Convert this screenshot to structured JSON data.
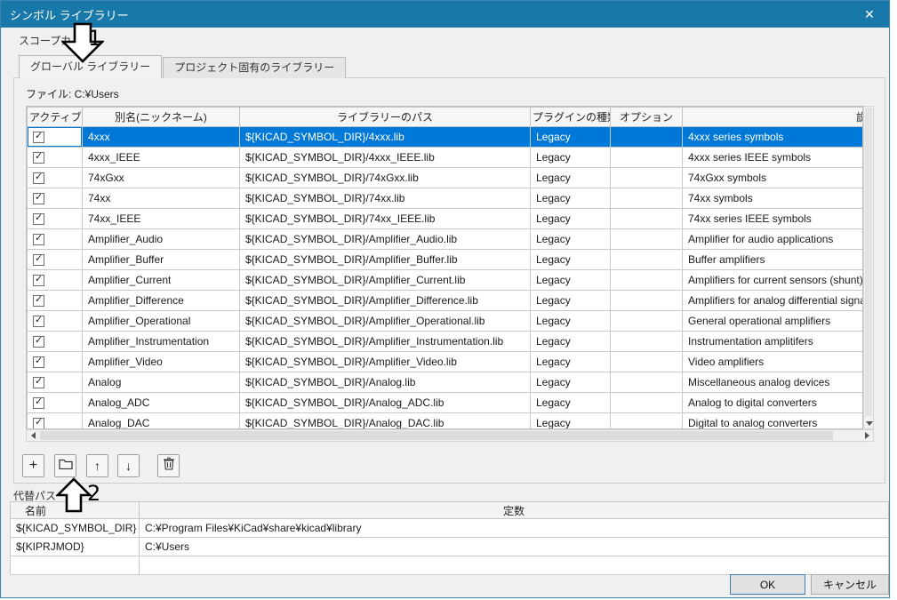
{
  "colors": {
    "titlebar": "#1878aa",
    "selection": "#0078d7",
    "dialog_bg": "#f0f0f0"
  },
  "dialog": {
    "title": "シンボル ライブラリー",
    "close_glyph": "✕"
  },
  "scope": {
    "label": "スコープカ",
    "tabs": [
      {
        "label": "グローバル ライブラリー",
        "active": true
      },
      {
        "label": "プロジェクト固有のライブラリー",
        "active": false
      }
    ],
    "file_label": "ファイル:  C:¥Users"
  },
  "grid": {
    "columns": [
      "アクティブ",
      "別名(ニックネーム)",
      "ライブラリーのパス",
      "プラグインの種類",
      "オプション",
      "説明"
    ],
    "rows": [
      {
        "active": true,
        "selected": true,
        "nickname": "4xxx",
        "path": "${KICAD_SYMBOL_DIR}/4xxx.lib",
        "plugin": "Legacy",
        "options": "",
        "description": "4xxx series symbols"
      },
      {
        "active": true,
        "selected": false,
        "nickname": "4xxx_IEEE",
        "path": "${KICAD_SYMBOL_DIR}/4xxx_IEEE.lib",
        "plugin": "Legacy",
        "options": "",
        "description": "4xxx series IEEE symbols"
      },
      {
        "active": true,
        "selected": false,
        "nickname": "74xGxx",
        "path": "${KICAD_SYMBOL_DIR}/74xGxx.lib",
        "plugin": "Legacy",
        "options": "",
        "description": "74xGxx symbols"
      },
      {
        "active": true,
        "selected": false,
        "nickname": "74xx",
        "path": "${KICAD_SYMBOL_DIR}/74xx.lib",
        "plugin": "Legacy",
        "options": "",
        "description": "74xx symbols"
      },
      {
        "active": true,
        "selected": false,
        "nickname": "74xx_IEEE",
        "path": "${KICAD_SYMBOL_DIR}/74xx_IEEE.lib",
        "plugin": "Legacy",
        "options": "",
        "description": "74xx series IEEE symbols"
      },
      {
        "active": true,
        "selected": false,
        "nickname": "Amplifier_Audio",
        "path": "${KICAD_SYMBOL_DIR}/Amplifier_Audio.lib",
        "plugin": "Legacy",
        "options": "",
        "description": "Amplifier for audio applications"
      },
      {
        "active": true,
        "selected": false,
        "nickname": "Amplifier_Buffer",
        "path": "${KICAD_SYMBOL_DIR}/Amplifier_Buffer.lib",
        "plugin": "Legacy",
        "options": "",
        "description": "Buffer amplifiers"
      },
      {
        "active": true,
        "selected": false,
        "nickname": "Amplifier_Current",
        "path": "${KICAD_SYMBOL_DIR}/Amplifier_Current.lib",
        "plugin": "Legacy",
        "options": "",
        "description": "Amplifiers for current sensors (shunt)"
      },
      {
        "active": true,
        "selected": false,
        "nickname": "Amplifier_Difference",
        "path": "${KICAD_SYMBOL_DIR}/Amplifier_Difference.lib",
        "plugin": "Legacy",
        "options": "",
        "description": "Amplifiers for analog differential signa"
      },
      {
        "active": true,
        "selected": false,
        "nickname": "Amplifier_Operational",
        "path": "${KICAD_SYMBOL_DIR}/Amplifier_Operational.lib",
        "plugin": "Legacy",
        "options": "",
        "description": "General operational amplifiers"
      },
      {
        "active": true,
        "selected": false,
        "nickname": "Amplifier_Instrumentation",
        "path": "${KICAD_SYMBOL_DIR}/Amplifier_Instrumentation.lib",
        "plugin": "Legacy",
        "options": "",
        "description": "Instrumentation amplitifers"
      },
      {
        "active": true,
        "selected": false,
        "nickname": "Amplifier_Video",
        "path": "${KICAD_SYMBOL_DIR}/Amplifier_Video.lib",
        "plugin": "Legacy",
        "options": "",
        "description": "Video amplifiers"
      },
      {
        "active": true,
        "selected": false,
        "nickname": "Analog",
        "path": "${KICAD_SYMBOL_DIR}/Analog.lib",
        "plugin": "Legacy",
        "options": "",
        "description": "Miscellaneous analog devices"
      },
      {
        "active": true,
        "selected": false,
        "nickname": "Analog_ADC",
        "path": "${KICAD_SYMBOL_DIR}/Analog_ADC.lib",
        "plugin": "Legacy",
        "options": "",
        "description": "Analog to digital converters"
      },
      {
        "active": true,
        "selected": false,
        "nickname": "Analog_DAC",
        "path": "${KICAD_SYMBOL_DIR}/Analog_DAC.lib",
        "plugin": "Legacy",
        "options": "",
        "description": "Digital to analog converters"
      }
    ]
  },
  "toolbar": {
    "add_glyph": "+",
    "up_glyph": "↑",
    "down_glyph": "↓"
  },
  "paths": {
    "label": "代替パス",
    "columns": [
      "名前",
      "定数"
    ],
    "rows": [
      {
        "name": "${KICAD_SYMBOL_DIR}",
        "value": "C:¥Program Files¥KiCad¥share¥kicad¥library"
      },
      {
        "name": "${KIPRJMOD}",
        "value": "C:¥Users"
      },
      {
        "name": "",
        "value": ""
      }
    ]
  },
  "footer": {
    "ok": "OK",
    "cancel": "キャンセル"
  },
  "annotations": {
    "label_1": "1",
    "label_2": "2"
  }
}
